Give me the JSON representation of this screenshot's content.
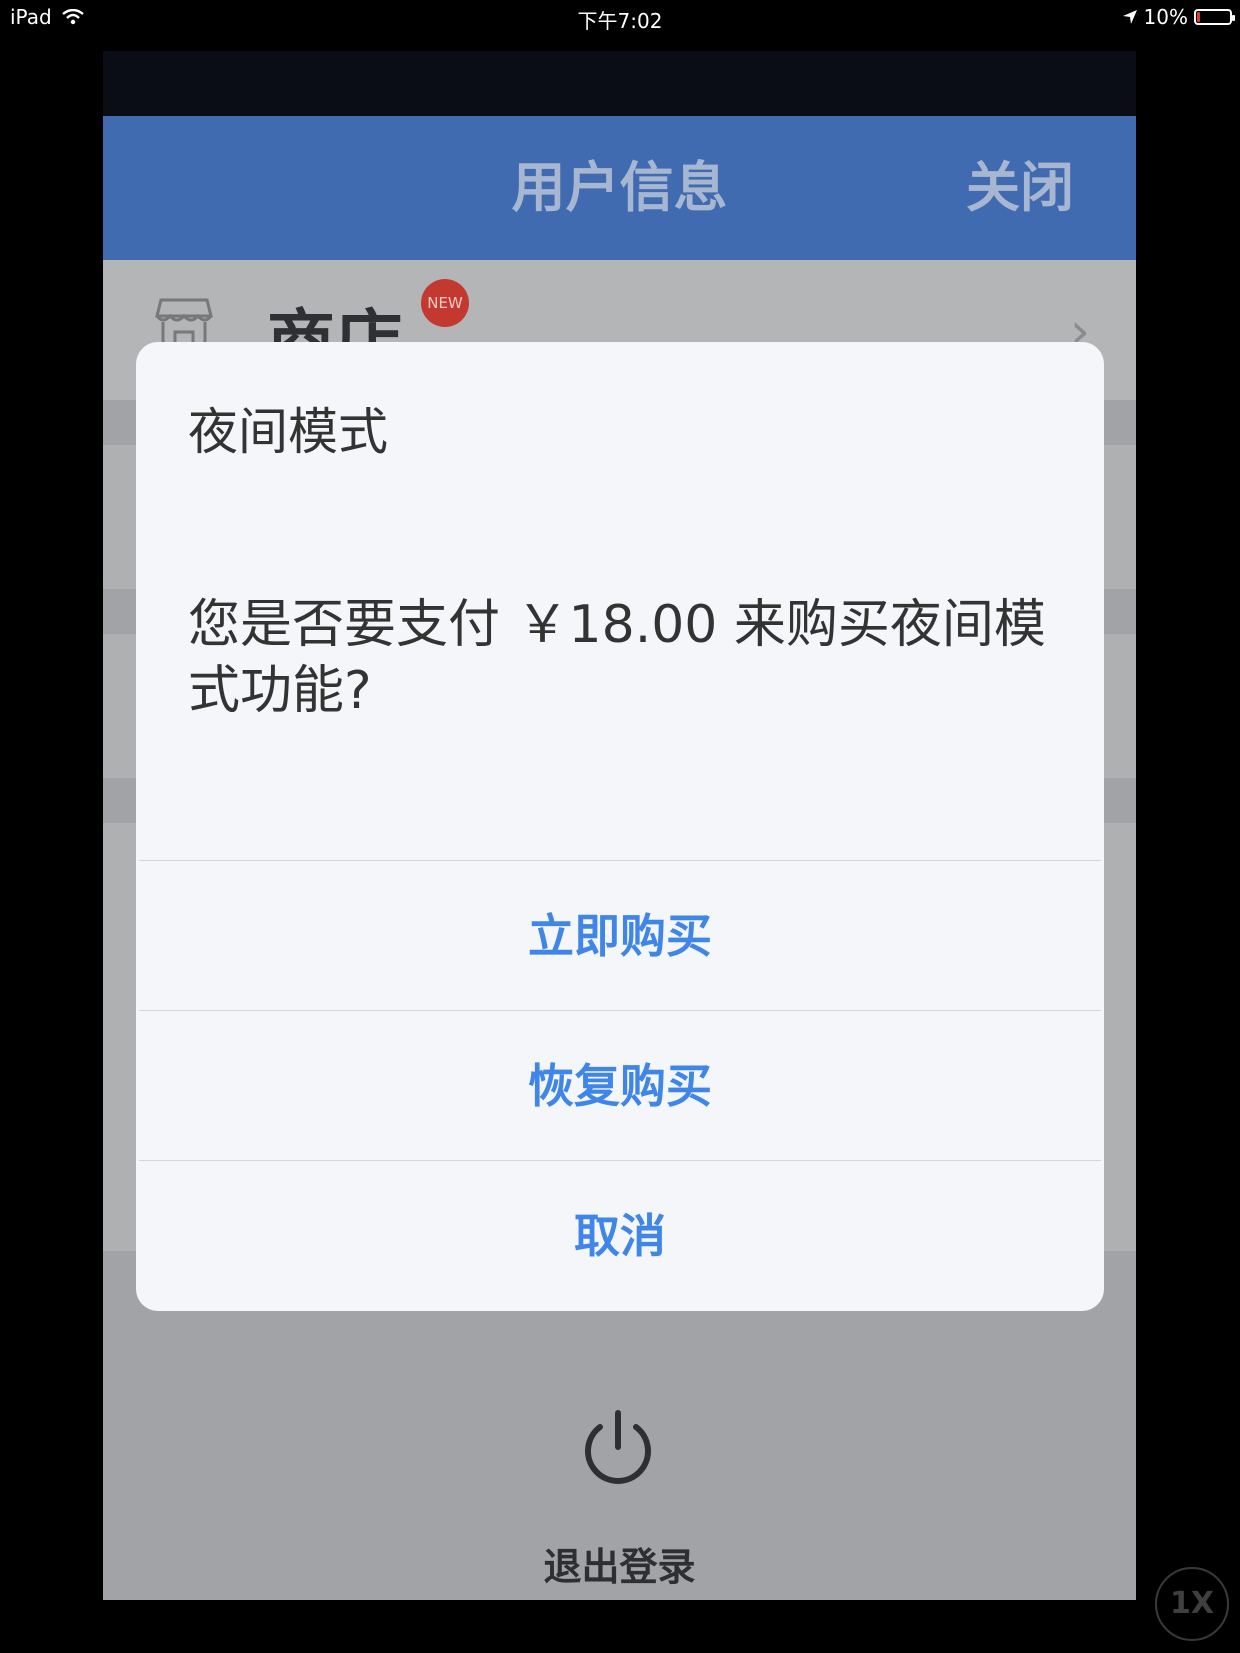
{
  "status_bar": {
    "device": "iPad",
    "time": "下午7:02",
    "battery_percent": "10%",
    "battery_level": 0.1
  },
  "nav": {
    "title": "用户信息",
    "close_label": "关闭"
  },
  "shop_row": {
    "label": "商店",
    "badge": "NEW"
  },
  "dialog": {
    "title": "夜间模式",
    "message": "您是否要支付 ￥18.00 来购买夜间模式功能?",
    "buttons": [
      {
        "label": "立即购买"
      },
      {
        "label": "恢复购买"
      },
      {
        "label": "取消"
      }
    ],
    "button_color": "#3f86e8"
  },
  "logout": {
    "label": "退出登录"
  },
  "zoom": {
    "label": "1X"
  },
  "colors": {
    "nav_bar": "#416bb1",
    "badge": "#c3392f"
  }
}
